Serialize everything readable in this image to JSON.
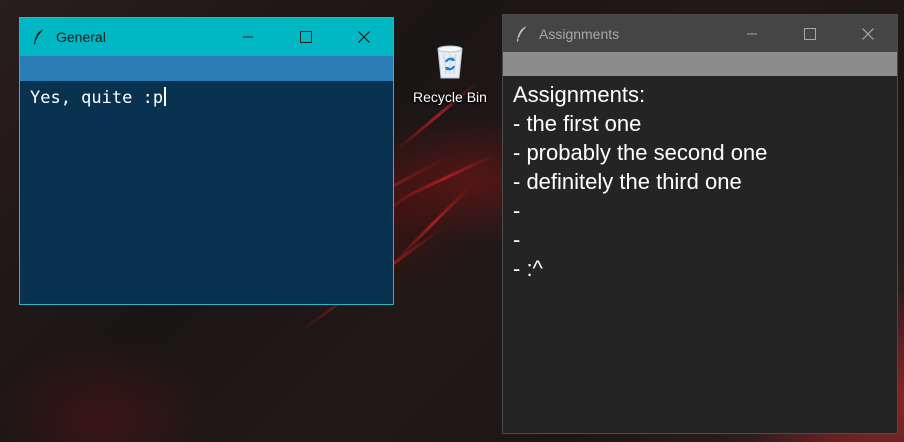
{
  "desktop": {
    "recycle_bin": {
      "label": "Recycle Bin",
      "icon": "recycle-bin-icon"
    }
  },
  "general_window": {
    "title": "General",
    "icon": "feather-icon",
    "controls": [
      "minimize-icon",
      "maximize-icon",
      "close-icon"
    ],
    "text_content": "Yes, quite :p",
    "colors": {
      "titlebar": "#00b7c3",
      "strip": "#2b7db6",
      "body": "#093251"
    }
  },
  "assignments_window": {
    "title": "Assignments",
    "icon": "feather-icon",
    "controls": [
      "minimize-icon",
      "maximize-icon",
      "close-icon"
    ],
    "lines": [
      "Assignments:",
      "- the first one",
      "- probably the second one",
      "- definitely the third one",
      "-",
      "-",
      "- :^"
    ],
    "colors": {
      "titlebar": "#454545",
      "strip": "#8c8c8c",
      "body": "#242424"
    }
  }
}
